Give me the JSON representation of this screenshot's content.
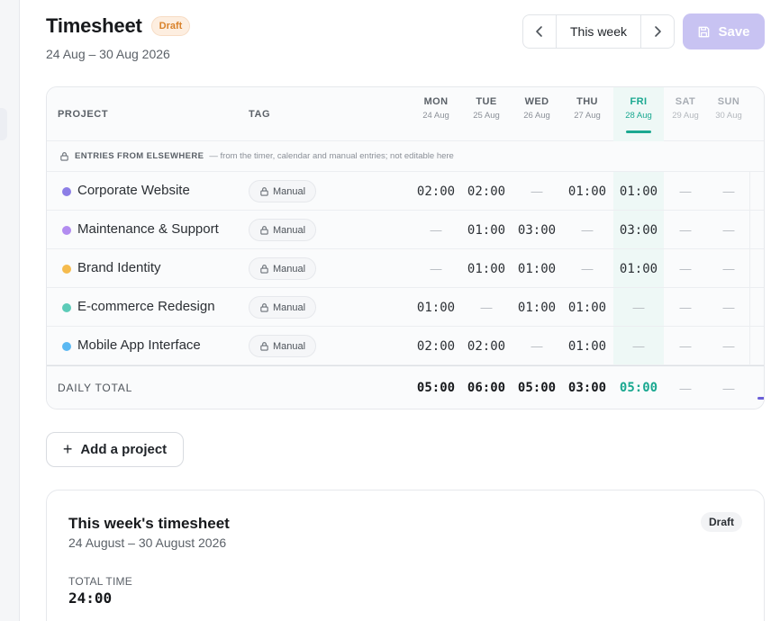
{
  "header": {
    "title": "Timesheet",
    "status": "Draft",
    "date_range": "24 Aug – 30 Aug 2026"
  },
  "week_nav": {
    "label": "This week",
    "prev_icon": "chevron-left-icon",
    "next_icon": "chevron-right-icon"
  },
  "save": {
    "label": "Save",
    "icon": "floppy-disk-icon",
    "state": "disabled"
  },
  "grid": {
    "col_project": "PROJECT",
    "col_tag": "TAG",
    "days": [
      {
        "name": "MON",
        "date": "24 Aug"
      },
      {
        "name": "TUE",
        "date": "25 Aug"
      },
      {
        "name": "WED",
        "date": "26 Aug"
      },
      {
        "name": "THU",
        "date": "27 Aug"
      },
      {
        "name": "FRI",
        "date": "28 Aug"
      },
      {
        "name": "SAT",
        "date": "29 Aug"
      },
      {
        "name": "SUN",
        "date": "30 Aug"
      }
    ],
    "notice_title": "ENTRIES FROM ELSEWHERE",
    "notice_text": "— from the timer, calendar and manual entries; not editable here",
    "rows": [
      {
        "project": "Corporate Website",
        "color": "#8c7ee6",
        "tag": "Manual",
        "cells": [
          "02:00",
          "02:00",
          "—",
          "01:00",
          "01:00",
          "—",
          "—"
        ]
      },
      {
        "project": "Maintenance & Support",
        "color": "#b28cf0",
        "tag": "Manual",
        "cells": [
          "—",
          "01:00",
          "03:00",
          "—",
          "03:00",
          "—",
          "—"
        ]
      },
      {
        "project": "Brand Identity",
        "color": "#f5bb4d",
        "tag": "Manual",
        "cells": [
          "—",
          "01:00",
          "01:00",
          "—",
          "01:00",
          "—",
          "—"
        ]
      },
      {
        "project": "E-commerce Redesign",
        "color": "#5ccbb8",
        "tag": "Manual",
        "cells": [
          "01:00",
          "—",
          "01:00",
          "01:00",
          "—",
          "—",
          "—"
        ]
      },
      {
        "project": "Mobile App Interface",
        "color": "#5ab8f2",
        "tag": "Manual",
        "cells": [
          "02:00",
          "02:00",
          "—",
          "01:00",
          "—",
          "—",
          "—"
        ]
      }
    ],
    "total_label": "DAILY TOTAL",
    "totals": [
      "05:00",
      "06:00",
      "05:00",
      "03:00",
      "05:00",
      "—",
      "—"
    ],
    "accent": "#1aa890"
  },
  "add_project": {
    "label": "Add a project",
    "icon": "plus-icon"
  },
  "summary": {
    "title": "This week's timesheet",
    "range": "24 August – 30 August 2026",
    "badge": "Draft",
    "total_time_label": "TOTAL TIME",
    "total_time_value": "24:00"
  }
}
